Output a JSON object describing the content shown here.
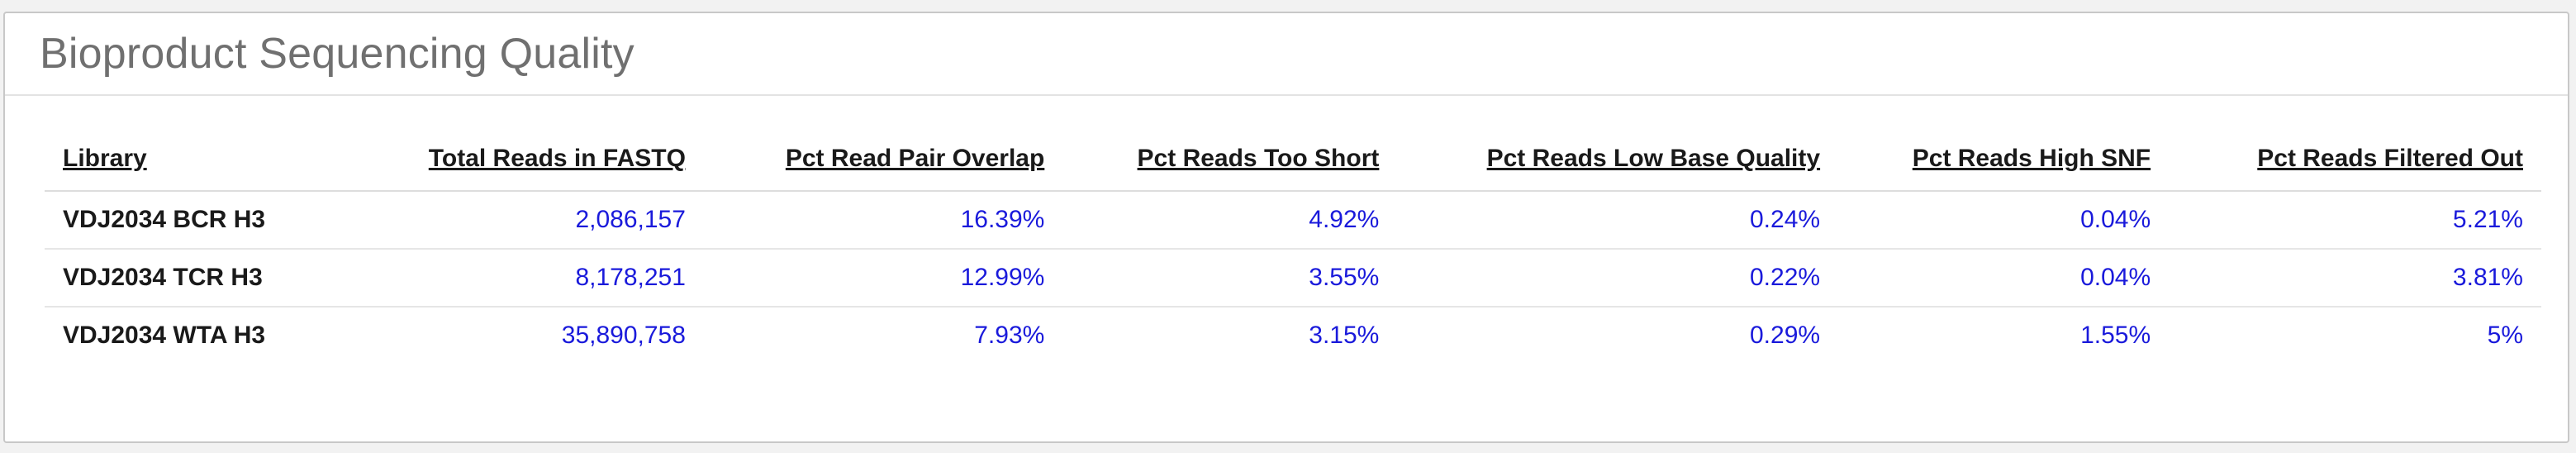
{
  "panel": {
    "title": "Bioproduct Sequencing Quality"
  },
  "table": {
    "columns": [
      "Library",
      "Total Reads in FASTQ",
      "Pct Read Pair Overlap",
      "Pct Reads Too Short",
      "Pct Reads Low Base Quality",
      "Pct Reads High SNF",
      "Pct Reads Filtered Out"
    ],
    "rows": [
      [
        "VDJ2034 BCR H3",
        "2,086,157",
        "16.39%",
        "4.92%",
        "0.24%",
        "0.04%",
        "5.21%"
      ],
      [
        "VDJ2034 TCR H3",
        "8,178,251",
        "12.99%",
        "3.55%",
        "0.22%",
        "0.04%",
        "3.81%"
      ],
      [
        "VDJ2034 WTA H3",
        "35,890,758",
        "7.93%",
        "3.15%",
        "0.29%",
        "1.55%",
        "5%"
      ]
    ]
  },
  "colors": {
    "value_text": "#1a1adb",
    "label_text": "#1a1a1a",
    "title_text": "#707070"
  }
}
